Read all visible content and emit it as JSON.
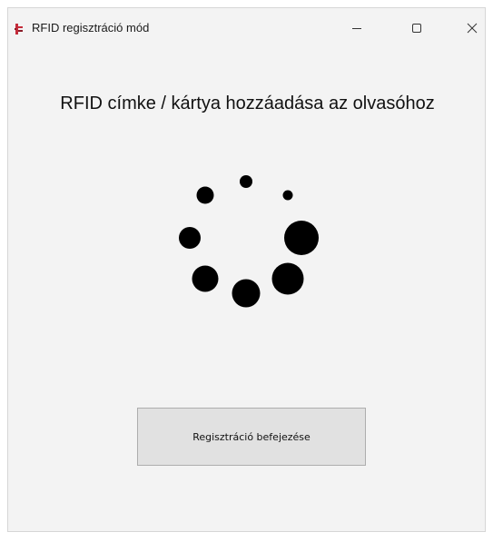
{
  "window": {
    "title": "RFID regisztráció mód",
    "icon": "rfid-app-icon",
    "controls": {
      "minimize": "minimize-icon",
      "maximize": "maximize-icon",
      "close": "close-icon"
    }
  },
  "main": {
    "heading": "RFID címke / kártya hozzáadása az olvasóhoz",
    "spinner": {
      "icon": "loading-spinner",
      "dot_count": 8
    },
    "finish_button_label": "Regisztráció befejezése"
  },
  "colors": {
    "window_background": "#f3f3f3",
    "button_background": "#e1e1e1",
    "button_border": "#adadad",
    "spinner_dots": "#000000",
    "app_icon": "#c42b3a"
  }
}
